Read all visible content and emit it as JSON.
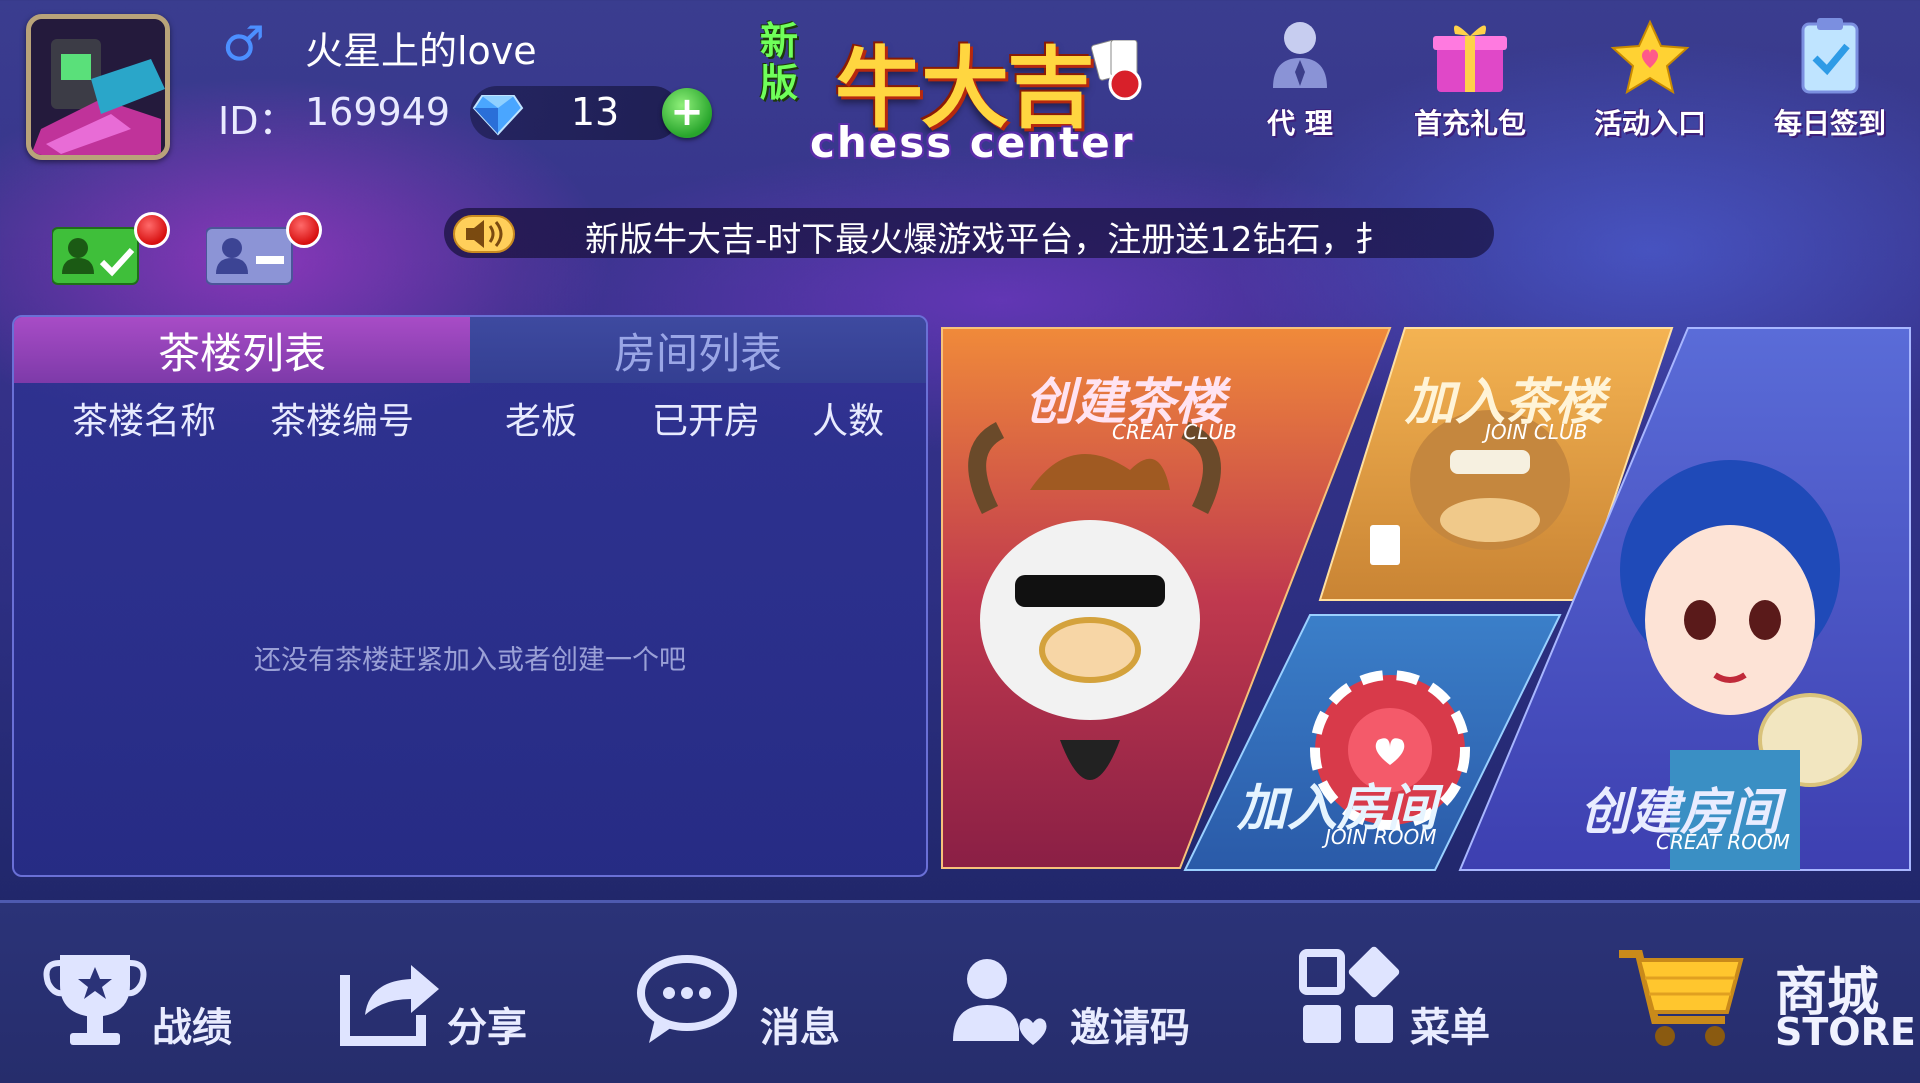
{
  "profile": {
    "nickname": "火星上的love",
    "id_label": "ID：",
    "id_value": "169949",
    "diamonds": "13"
  },
  "logo": {
    "badge": "新版",
    "title": "牛大吉",
    "subtitle": "chess center"
  },
  "top_buttons": [
    {
      "label": "代 理",
      "icon": "agent-icon"
    },
    {
      "label": "首充礼包",
      "icon": "gift-icon"
    },
    {
      "label": "活动入口",
      "icon": "star-icon"
    },
    {
      "label": "每日签到",
      "icon": "clipboard-check-icon"
    }
  ],
  "notice": {
    "text": "新版牛大吉-时下最火爆游戏平台，注册送12钻石，扌"
  },
  "list_panel": {
    "tabs": [
      "茶楼列表",
      "房间列表"
    ],
    "active_tab": 0,
    "columns": [
      "茶楼名称",
      "茶楼编号",
      "老板",
      "已开房",
      "人数"
    ],
    "empty_message": "还没有茶楼赶紧加入或者创建一个吧"
  },
  "cards": {
    "create_club": {
      "title": "创建茶楼",
      "sub": "CREAT CLUB"
    },
    "join_club": {
      "title": "加入茶楼",
      "sub": "JOIN CLUB"
    },
    "join_room": {
      "title": "加入房间",
      "sub": "JOIN ROOM"
    },
    "create_room": {
      "title": "创建房间",
      "sub": "CREAT ROOM"
    }
  },
  "bottom_nav": [
    {
      "label": "战绩",
      "icon": "trophy-icon"
    },
    {
      "label": "分享",
      "icon": "share-icon"
    },
    {
      "label": "消息",
      "icon": "message-icon"
    },
    {
      "label": "邀请码",
      "icon": "invite-icon"
    },
    {
      "label": "菜单",
      "icon": "menu-grid-icon"
    }
  ],
  "store": {
    "label_cn": "商城",
    "label_en": "STORE",
    "icon": "cart-icon"
  },
  "colors": {
    "accent_gold": "#ffd640",
    "active_tab": "#a84cc6",
    "panel": "#2d3291",
    "red_dot": "#d70f0f",
    "green_add": "#28a52c"
  }
}
